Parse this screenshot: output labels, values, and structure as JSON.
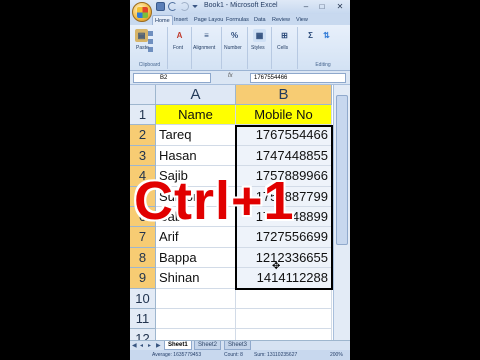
{
  "window": {
    "title": "Book1 - Microsoft Excel",
    "controls": [
      "–",
      "□",
      "✕"
    ]
  },
  "ribbon": {
    "tabs": [
      "Home",
      "Insert",
      "Page Layou",
      "Formulas",
      "Data",
      "Review",
      "View"
    ],
    "active_tab": "Home",
    "groups": {
      "paste": "Paste",
      "font": "Font",
      "alignment": "Alignment",
      "number": "Number",
      "styles": "Styles",
      "cells": "Cells",
      "clipboard": "Clipboard",
      "editing": "Editing"
    }
  },
  "formula_bar": {
    "name_box": "B2",
    "fx": "fx",
    "value": "1767554466"
  },
  "grid": {
    "columns": [
      "A",
      "B"
    ],
    "rows": [
      "1",
      "2",
      "3",
      "4",
      "5",
      "6",
      "7",
      "8",
      "9",
      "10",
      "11",
      "12"
    ],
    "header": {
      "name": "Name",
      "mobile": "Mobile No"
    },
    "data": [
      {
        "name": "Tareq",
        "mobile": "1767554466"
      },
      {
        "name": "Hasan",
        "mobile": "1747448855"
      },
      {
        "name": "Sajib",
        "mobile": "1757889966"
      },
      {
        "name": "Sumon",
        "mobile": "1754887799"
      },
      {
        "name": "Babu",
        "mobile": "1728448899"
      },
      {
        "name": "Arif",
        "mobile": "1727556699"
      },
      {
        "name": "Bappa",
        "mobile": "1212336655"
      },
      {
        "name": "Shinan",
        "mobile": "1414112288"
      }
    ]
  },
  "sheets": [
    "Sheet1",
    "Sheet2",
    "Sheet3"
  ],
  "active_sheet": "Sheet1",
  "status": {
    "average": "Average: 1635779453",
    "count": "Count: 8",
    "sum": "Sum: 13110235627",
    "zoom": "200%"
  },
  "overlay": {
    "text": "Ctrl+1"
  },
  "colors": {
    "header_fill": "#ffff00",
    "overlay_text": "#e10000",
    "selected_header": "#f7cc73"
  }
}
